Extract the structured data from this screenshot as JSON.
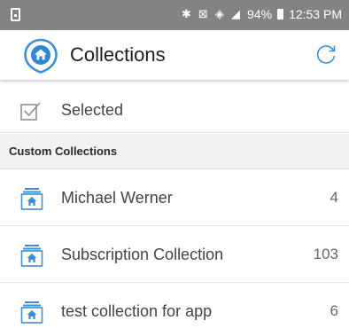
{
  "status_bar": {
    "battery": "94%",
    "time": "12:53 PM",
    "icons": "✱ ⊠ ◈ ◢"
  },
  "toolbar": {
    "title": "Collections",
    "logo_icon": "home-pin-icon",
    "refresh_icon": "refresh-icon"
  },
  "selected_row": {
    "label": "Selected",
    "icon": "checkbox-icon"
  },
  "section": {
    "title": "Custom Collections"
  },
  "collections": [
    {
      "name": "Michael Werner",
      "count": "4"
    },
    {
      "name": "Subscription Collection",
      "count": "103"
    },
    {
      "name": "test collection for app",
      "count": "6"
    }
  ],
  "colors": {
    "accent": "#3a8fd6",
    "status_bar": "#7f7f7f",
    "section_bg": "#f2f2f2"
  }
}
